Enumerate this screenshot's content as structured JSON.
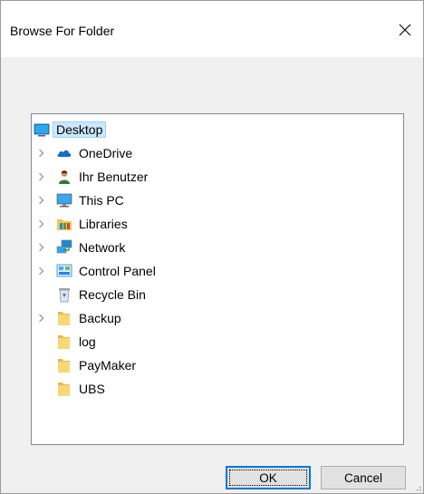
{
  "dialog": {
    "title": "Browse For Folder",
    "ok_label": "OK",
    "cancel_label": "Cancel"
  },
  "tree": {
    "root": {
      "label": "Desktop",
      "icon": "desktop-icon",
      "selected": true
    },
    "items": [
      {
        "label": "OneDrive",
        "icon": "onedrive-icon",
        "expandable": true
      },
      {
        "label": "Ihr Benutzer",
        "icon": "user-icon",
        "expandable": true
      },
      {
        "label": "This PC",
        "icon": "this-pc-icon",
        "expandable": true
      },
      {
        "label": "Libraries",
        "icon": "libraries-icon",
        "expandable": true
      },
      {
        "label": "Network",
        "icon": "network-icon",
        "expandable": true
      },
      {
        "label": "Control Panel",
        "icon": "control-panel-icon",
        "expandable": true
      },
      {
        "label": "Recycle Bin",
        "icon": "recycle-bin-icon",
        "expandable": false
      },
      {
        "label": "Backup",
        "icon": "folder-icon",
        "expandable": true
      },
      {
        "label": "log",
        "icon": "folder-icon",
        "expandable": false
      },
      {
        "label": "PayMaker",
        "icon": "folder-icon",
        "expandable": false
      },
      {
        "label": "UBS",
        "icon": "folder-icon",
        "expandable": false
      }
    ]
  },
  "colors": {
    "selection_fill": "#cce8ff",
    "selection_border": "#99d1ff",
    "default_button_border": "#0078d7",
    "folder": "#f8d775"
  }
}
